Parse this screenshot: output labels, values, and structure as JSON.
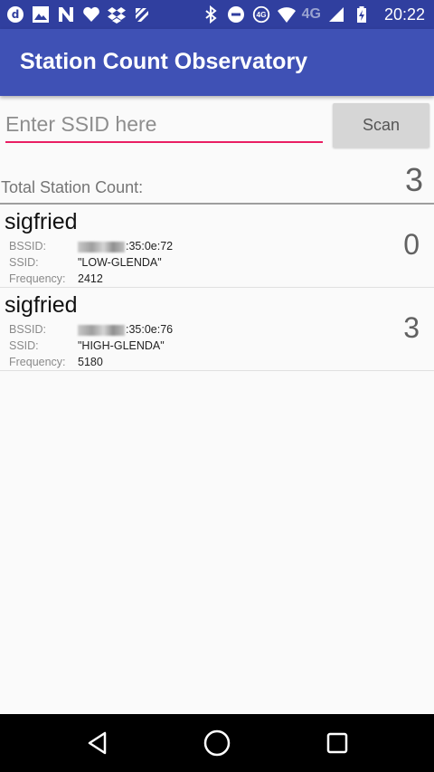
{
  "status_bar": {
    "left_icons": [
      "app-d-icon",
      "image-icon",
      "n-app-icon",
      "heart-icon",
      "dropbox-icon",
      "feedly-icon"
    ],
    "right_icons": [
      "bluetooth-icon",
      "do-not-disturb-icon",
      "wifi-4g-icon",
      "network-4g-icon",
      "signal-icon",
      "battery-charging-icon"
    ],
    "wifi_badge": "4G",
    "network_type": "4G",
    "time": "20:22"
  },
  "app_bar": {
    "title": "Station Count Observatory"
  },
  "search": {
    "placeholder": "Enter SSID here",
    "value": "",
    "scan_label": "Scan"
  },
  "total": {
    "label": "Total Station Count:",
    "value": "3"
  },
  "field_labels": {
    "bssid": "BSSID:",
    "ssid": "SSID:",
    "frequency": "Frequency:"
  },
  "stations": [
    {
      "name": "sigfried",
      "bssid_suffix": ":35:0e:72",
      "ssid": "\"LOW-GLENDA\"",
      "frequency": "2412",
      "count": "0"
    },
    {
      "name": "sigfried",
      "bssid_suffix": ":35:0e:76",
      "ssid": "\"HIGH-GLENDA\"",
      "frequency": "5180",
      "count": "3"
    }
  ],
  "nav_bar": {
    "buttons": [
      "back-icon",
      "home-icon",
      "recents-icon"
    ]
  },
  "colors": {
    "status_bar": "#303f9f",
    "app_bar": "#3f51b5",
    "accent": "#e91e63",
    "background": "#fafafa"
  }
}
